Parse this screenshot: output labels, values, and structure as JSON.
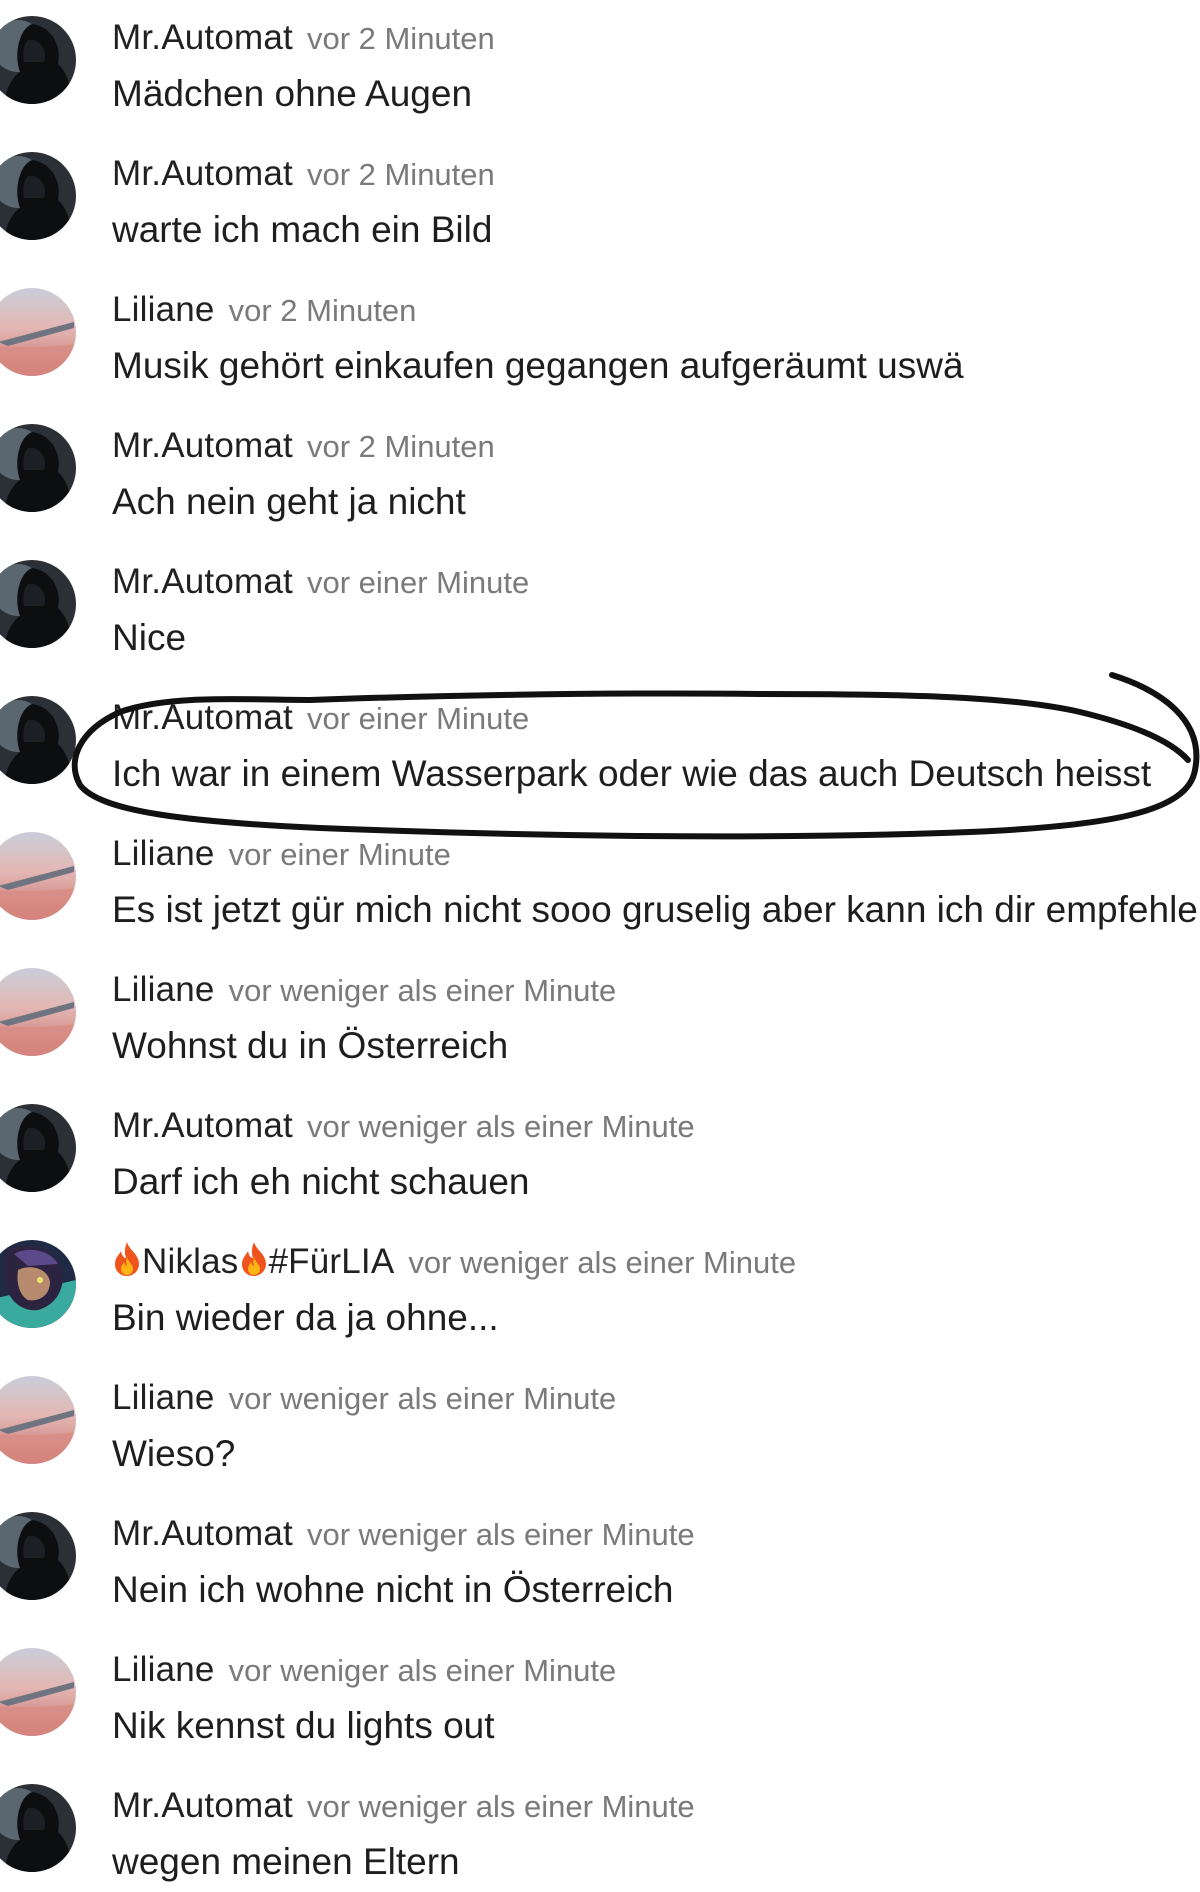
{
  "messages": [
    {
      "author": "Mr.Automat",
      "time": "vor 2 Minuten",
      "text": "Mädchen ohne Augen",
      "avatar": "hooded-figure"
    },
    {
      "author": "Mr.Automat",
      "time": "vor 2 Minuten",
      "text": "warte ich mach ein Bild",
      "avatar": "hooded-figure"
    },
    {
      "author": "Liliane",
      "time": "vor 2 Minuten",
      "text": "Musik gehört einkaufen gegangen aufgeräumt uswä",
      "avatar": "airplane-wing-sunset"
    },
    {
      "author": "Mr.Automat",
      "time": "vor 2 Minuten",
      "text": "Ach nein geht ja nicht",
      "avatar": "hooded-figure"
    },
    {
      "author": "Mr.Automat",
      "time": "vor einer Minute",
      "text": "Nice",
      "avatar": "hooded-figure"
    },
    {
      "author": "Mr.Automat",
      "time": "vor einer Minute",
      "text": "Ich war in einem Wasserpark oder wie das auch Deutsch heisst",
      "avatar": "hooded-figure",
      "circled": true
    },
    {
      "author": "Liliane",
      "time": "vor einer Minute",
      "text": "Es ist jetzt gür mich nicht sooo gruselig aber kann ich dir empfehle",
      "avatar": "airplane-wing-sunset"
    },
    {
      "author": "Liliane",
      "time": "vor weniger als einer Minute",
      "text": "Wohnst du in Österreich",
      "avatar": "airplane-wing-sunset"
    },
    {
      "author": "Mr.Automat",
      "time": "vor weniger als einer Minute",
      "text": "Darf ich eh nicht schauen",
      "avatar": "hooded-figure"
    },
    {
      "author": "Niklas",
      "author_suffix": "#FürLIA",
      "time": "vor weniger als einer Minute",
      "text": "Bin wieder da ja ohne...",
      "avatar": "anime-character",
      "name_icons": [
        "fire-icon",
        "fire-icon"
      ]
    },
    {
      "author": "Liliane",
      "time": "vor weniger als einer Minute",
      "text": "Wieso?",
      "avatar": "airplane-wing-sunset"
    },
    {
      "author": "Mr.Automat",
      "time": "vor weniger als einer Minute",
      "text": "Nein ich wohne nicht in Österreich",
      "avatar": "hooded-figure"
    },
    {
      "author": "Liliane",
      "time": "vor weniger als einer Minute",
      "text": "Nik kennst du lights out",
      "avatar": "airplane-wing-sunset"
    },
    {
      "author": "Mr.Automat",
      "time": "vor weniger als einer Minute",
      "text": "wegen meinen Eltern",
      "avatar": "hooded-figure"
    }
  ],
  "colors": {
    "name": "#212121",
    "time": "#7a7a7a",
    "text": "#1e1e1e",
    "annotation": "#111111"
  }
}
